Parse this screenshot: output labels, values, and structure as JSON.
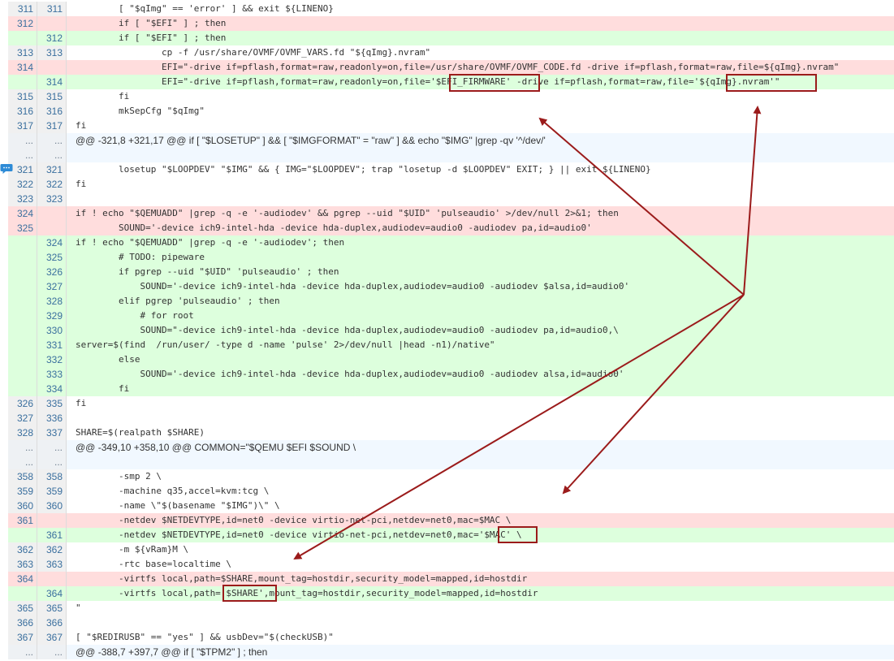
{
  "rows": [
    {
      "type": "ctx",
      "old": "311",
      "new": "311",
      "code": "        [ \"$qImg\" == 'error' ] && exit ${LINENO}"
    },
    {
      "type": "del",
      "old": "312",
      "new": "",
      "code": "        if [ \"$EFI\" ] ; then"
    },
    {
      "type": "add",
      "old": "",
      "new": "312",
      "code": "        if [ \"$EFI\" ] ; then"
    },
    {
      "type": "ctx",
      "old": "313",
      "new": "313",
      "code": "                cp -f /usr/share/OVMF/OVMF_VARS.fd \"${qImg}.nvram\""
    },
    {
      "type": "del",
      "old": "314",
      "new": "",
      "code": "                EFI=\"-drive if=pflash,format=raw,readonly=on,file=/usr/share/OVMF/OVMF_CODE.fd -drive if=pflash,format=raw,file=${qImg}.nvram\""
    },
    {
      "type": "add",
      "old": "",
      "new": "314",
      "code": "                EFI=\"-drive if=pflash,format=raw,readonly=on,file='$EFI_FIRMWARE' -drive if=pflash,format=raw,file='${qImg}.nvram'\""
    },
    {
      "type": "ctx",
      "old": "315",
      "new": "315",
      "code": "        fi"
    },
    {
      "type": "ctx",
      "old": "316",
      "new": "316",
      "code": "        mkSepCfg \"$qImg\""
    },
    {
      "type": "ctx",
      "old": "317",
      "new": "317",
      "code": "fi"
    },
    {
      "type": "hunk",
      "old": "...",
      "new": "...",
      "code": "@@ -321,8 +321,17 @@ if [ \"$LOSETUP\" ] && [ \"$IMGFORMAT\" = \"raw\" ] && echo \"$IMG\" |grep -qv '^/dev/'"
    },
    {
      "type": "hunk",
      "old": "...",
      "new": "...",
      "code": ""
    },
    {
      "type": "ctx",
      "old": "321",
      "new": "321",
      "code": "        losetup \"$LOOPDEV\" \"$IMG\" && { IMG=\"$LOOPDEV\"; trap \"losetup -d $LOOPDEV\" EXIT; } || exit ${LINENO}"
    },
    {
      "type": "ctx",
      "old": "322",
      "new": "322",
      "code": "fi"
    },
    {
      "type": "ctx",
      "old": "323",
      "new": "323",
      "code": ""
    },
    {
      "type": "del",
      "old": "324",
      "new": "",
      "code": "if ! echo \"$QEMUADD\" |grep -q -e '-audiodev' && pgrep --uid \"$UID\" 'pulseaudio' >/dev/null 2>&1; then"
    },
    {
      "type": "del",
      "old": "325",
      "new": "",
      "code": "        SOUND='-device ich9-intel-hda -device hda-duplex,audiodev=audio0 -audiodev pa,id=audio0'"
    },
    {
      "type": "add",
      "old": "",
      "new": "324",
      "code": "if ! echo \"$QEMUADD\" |grep -q -e '-audiodev'; then"
    },
    {
      "type": "add",
      "old": "",
      "new": "325",
      "code": "        # TODO: pipeware"
    },
    {
      "type": "add",
      "old": "",
      "new": "326",
      "code": "        if pgrep --uid \"$UID\" 'pulseaudio' ; then"
    },
    {
      "type": "add",
      "old": "",
      "new": "327",
      "code": "            SOUND='-device ich9-intel-hda -device hda-duplex,audiodev=audio0 -audiodev $alsa,id=audio0'"
    },
    {
      "type": "add",
      "old": "",
      "new": "328",
      "code": "        elif pgrep 'pulseaudio' ; then"
    },
    {
      "type": "add",
      "old": "",
      "new": "329",
      "code": "            # for root"
    },
    {
      "type": "add",
      "old": "",
      "new": "330",
      "code": "            SOUND=\"-device ich9-intel-hda -device hda-duplex,audiodev=audio0 -audiodev pa,id=audio0,\\"
    },
    {
      "type": "add",
      "old": "",
      "new": "331",
      "code": "server=$(find  /run/user/ -type d -name 'pulse' 2>/dev/null |head -n1)/native\""
    },
    {
      "type": "add",
      "old": "",
      "new": "332",
      "code": "        else"
    },
    {
      "type": "add",
      "old": "",
      "new": "333",
      "code": "            SOUND='-device ich9-intel-hda -device hda-duplex,audiodev=audio0 -audiodev alsa,id=audio0'"
    },
    {
      "type": "add",
      "old": "",
      "new": "334",
      "code": "        fi"
    },
    {
      "type": "ctx",
      "old": "326",
      "new": "335",
      "code": "fi"
    },
    {
      "type": "ctx",
      "old": "327",
      "new": "336",
      "code": ""
    },
    {
      "type": "ctx",
      "old": "328",
      "new": "337",
      "code": "SHARE=$(realpath $SHARE)"
    },
    {
      "type": "hunk",
      "old": "...",
      "new": "...",
      "code": "@@ -349,10 +358,10 @@ COMMON=\"$QEMU $EFI $SOUND \\"
    },
    {
      "type": "hunk",
      "old": "...",
      "new": "...",
      "code": ""
    },
    {
      "type": "ctx",
      "old": "358",
      "new": "358",
      "code": "        -smp 2 \\"
    },
    {
      "type": "ctx",
      "old": "359",
      "new": "359",
      "code": "        -machine q35,accel=kvm:tcg \\"
    },
    {
      "type": "ctx",
      "old": "360",
      "new": "360",
      "code": "        -name \\\"$(basename \"$IMG\")\\\" \\"
    },
    {
      "type": "del",
      "old": "361",
      "new": "",
      "code": "        -netdev $NETDEVTYPE,id=net0 -device virtio-net-pci,netdev=net0,mac=$MAC \\"
    },
    {
      "type": "add",
      "old": "",
      "new": "361",
      "code": "        -netdev $NETDEVTYPE,id=net0 -device virtio-net-pci,netdev=net0,mac='$MAC' \\"
    },
    {
      "type": "ctx",
      "old": "362",
      "new": "362",
      "code": "        -m ${vRam}M \\"
    },
    {
      "type": "ctx",
      "old": "363",
      "new": "363",
      "code": "        -rtc base=localtime \\"
    },
    {
      "type": "del",
      "old": "364",
      "new": "",
      "code": "        -virtfs local,path=$SHARE,mount_tag=hostdir,security_model=mapped,id=hostdir"
    },
    {
      "type": "add",
      "old": "",
      "new": "364",
      "code": "        -virtfs local,path='$SHARE',mount_tag=hostdir,security_model=mapped,id=hostdir"
    },
    {
      "type": "ctx",
      "old": "365",
      "new": "365",
      "code": "\""
    },
    {
      "type": "ctx",
      "old": "366",
      "new": "366",
      "code": ""
    },
    {
      "type": "ctx",
      "old": "367",
      "new": "367",
      "code": "[ \"$REDIRUSB\" == \"yes\" ] && usbDev=\"$(checkUSB)\""
    },
    {
      "type": "hunk",
      "old": "...",
      "new": "...",
      "code": "@@ -388,7 +397,7 @@ if [ \"$TPM2\" ] ; then"
    }
  ],
  "colors": {
    "deleted_bg": "#ffdddd",
    "added_bg": "#ddffdd",
    "annotation": "#9b1b1b"
  },
  "icons": {
    "comment": "comment-bubble-icon"
  }
}
